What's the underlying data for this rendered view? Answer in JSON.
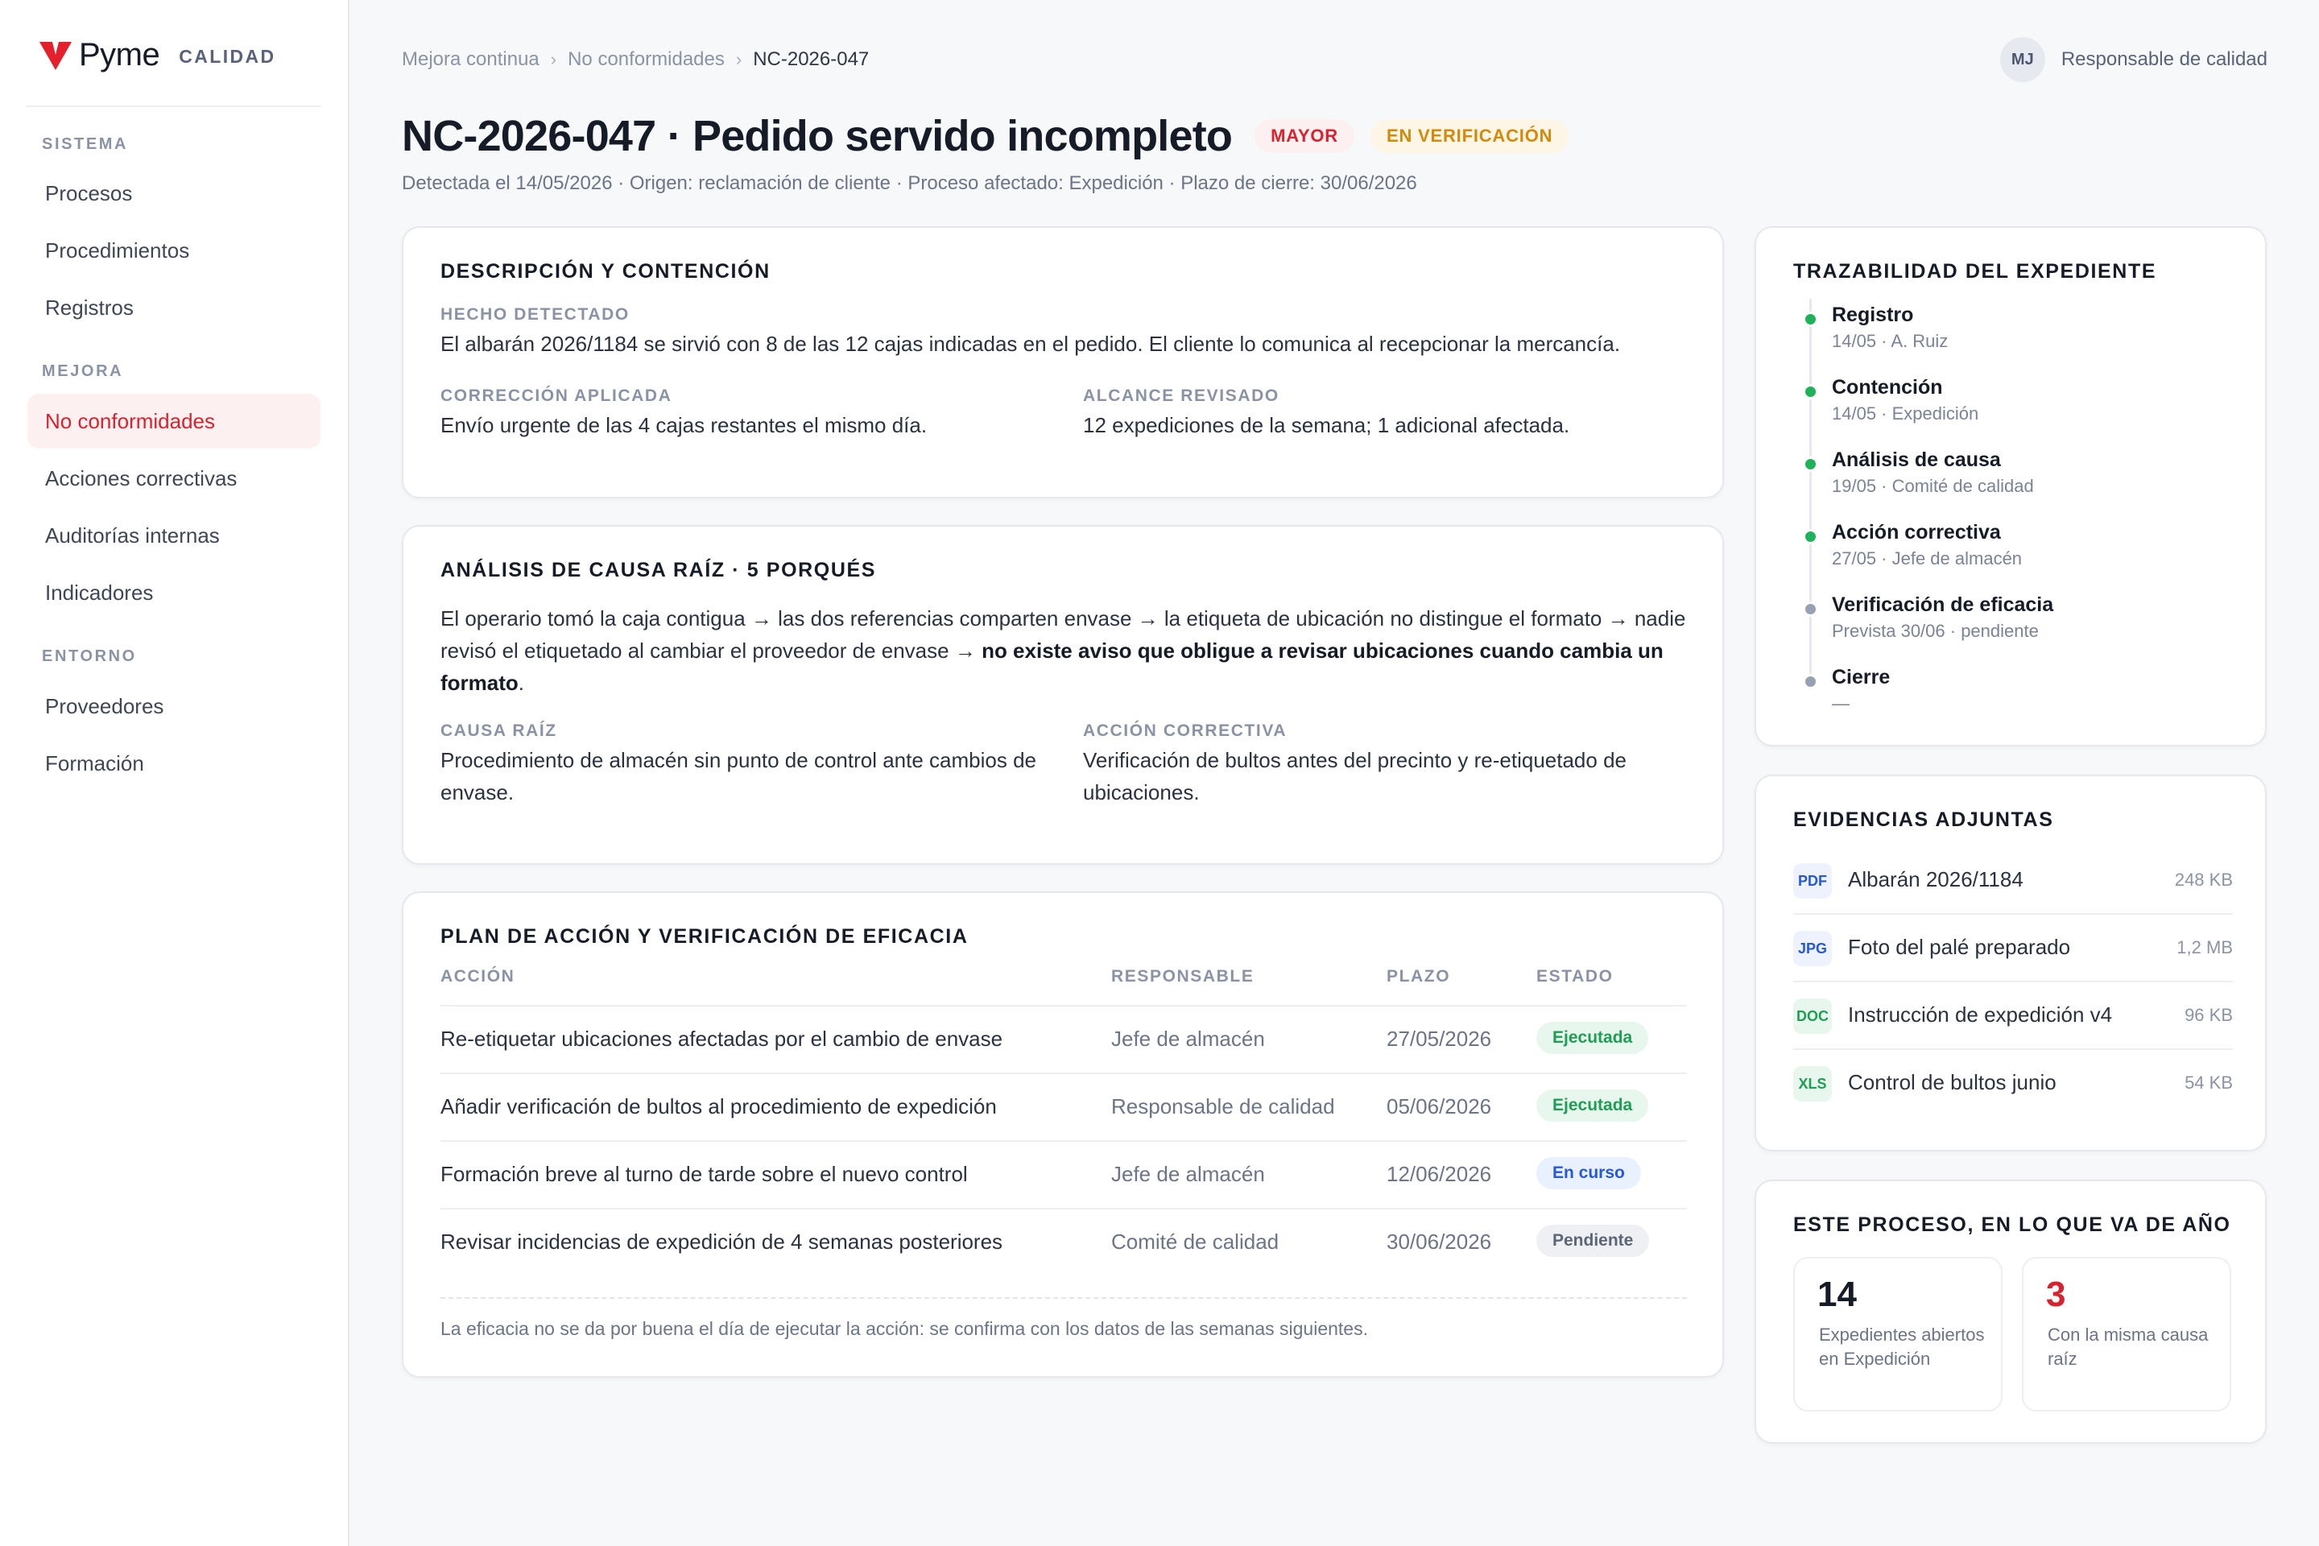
{
  "app": {
    "brand_name": "Pyme",
    "brand_tag": "CALIDAD"
  },
  "sidebar": {
    "sections": [
      {
        "title": "SISTEMA",
        "items": [
          "Procesos",
          "Procedimientos",
          "Registros"
        ]
      },
      {
        "title": "MEJORA",
        "items": [
          "No conformidades",
          "Acciones correctivas",
          "Auditorías internas",
          "Indicadores"
        ]
      },
      {
        "title": "ENTORNO",
        "items": [
          "Proveedores",
          "Formación"
        ]
      }
    ],
    "active_item": "No conformidades"
  },
  "breadcrumb": {
    "items": [
      "Mejora continua",
      "No conformidades",
      "NC-2026-047"
    ],
    "separator": "›"
  },
  "user": {
    "initials": "MJ",
    "role": "Responsable de calidad"
  },
  "header": {
    "title": "NC-2026-047 · Pedido servido incompleto",
    "badge_severity": "MAYOR",
    "badge_status": "EN VERIFICACIÓN",
    "subtitle": "Detectada el 14/05/2026 · Origen: reclamación de cliente · Proceso afectado: Expedición · Plazo de cierre: 30/06/2026"
  },
  "description": {
    "title": "DESCRIPCIÓN Y CONTENCIÓN",
    "fact_label": "HECHO DETECTADO",
    "fact_value": "El albarán 2026/1184 se sirvió con 8 de las 12 cajas indicadas en el pedido. El cliente lo comunica al recepcionar la mercancía.",
    "correction_label": "CORRECCIÓN APLICADA",
    "correction_value": "Envío urgente de las 4 cajas restantes el mismo día.",
    "scope_label": "ALCANCE REVISADO",
    "scope_value": "12 expediciones de la semana; 1 adicional afectada."
  },
  "analysis": {
    "title": "ANÁLISIS DE CAUSA RAÍZ · 5 PORQUÉS",
    "chain_text": "El operario tomó la caja contigua → las dos referencias comparten envase → la etiqueta de ubicación no distingue el formato → nadie revisó el etiquetado al cambiar el proveedor de envase →",
    "chain_conclusion": "no existe aviso que obligue a revisar ubicaciones cuando cambia un formato",
    "chain_end": ".",
    "root_label": "CAUSA RAÍZ",
    "root_value": "Procedimiento de almacén sin punto de control ante cambios de envase.",
    "action_label": "ACCIÓN CORRECTIVA",
    "action_value": "Verificación de bultos antes del precinto y re-etiquetado de ubicaciones."
  },
  "plan": {
    "title": "PLAN DE ACCIÓN Y VERIFICACIÓN DE EFICACIA",
    "columns": [
      "ACCIÓN",
      "RESPONSABLE",
      "PLAZO",
      "ESTADO"
    ],
    "rows": [
      {
        "action": "Re-etiquetar ubicaciones afectadas por el cambio de envase",
        "owner": "Jefe de almacén",
        "due": "27/05/2026",
        "status": "Ejecutada"
      },
      {
        "action": "Añadir verificación de bultos al procedimiento de expedición",
        "owner": "Responsable de calidad",
        "due": "05/06/2026",
        "status": "Ejecutada"
      },
      {
        "action": "Formación breve al turno de tarde sobre el nuevo control",
        "owner": "Jefe de almacén",
        "due": "12/06/2026",
        "status": "En curso"
      },
      {
        "action": "Revisar incidencias de expedición de 4 semanas posteriores",
        "owner": "Comité de calidad",
        "due": "30/06/2026",
        "status": "Pendiente"
      }
    ],
    "footnote": "La eficacia no se da por buena el día de ejecutar la acción: se confirma con los datos de las semanas siguientes."
  },
  "traceability": {
    "title": "TRAZABILIDAD DEL EXPEDIENTE",
    "steps": [
      {
        "name": "Registro",
        "meta": "14/05 · A. Ruiz",
        "state": "done"
      },
      {
        "name": "Contención",
        "meta": "14/05 · Expedición",
        "state": "done"
      },
      {
        "name": "Análisis de causa",
        "meta": "19/05 · Comité de calidad",
        "state": "done"
      },
      {
        "name": "Acción correctiva",
        "meta": "27/05 · Jefe de almacén",
        "state": "done"
      },
      {
        "name": "Verificación de eficacia",
        "meta": "Prevista 30/06 · pendiente",
        "state": "pending"
      },
      {
        "name": "Cierre",
        "meta": "—",
        "state": "pending"
      }
    ]
  },
  "evidence": {
    "title": "EVIDENCIAS ADJUNTAS",
    "files": [
      {
        "type": "PDF",
        "name": "Albarán 2026/1184",
        "size": "248 KB"
      },
      {
        "type": "JPG",
        "name": "Foto del palé preparado",
        "size": "1,2 MB"
      },
      {
        "type": "DOC",
        "name": "Instrucción de expedición v4",
        "size": "96 KB"
      },
      {
        "type": "XLS",
        "name": "Control de bultos junio",
        "size": "54 KB"
      }
    ]
  },
  "stats": {
    "title": "ESTE PROCESO, EN LO QUE VA DE AÑO",
    "items": [
      {
        "value": "14",
        "label": "Expedientes abiertos en Expedición",
        "color": "#161b28"
      },
      {
        "value": "3",
        "label": "Con la misma causa raíz",
        "color": "#d8232f"
      }
    ]
  },
  "colors": {
    "accent": "#d8232f",
    "success": "#1f9d55",
    "info": "#2559d6",
    "warning": "#d38a0a"
  }
}
